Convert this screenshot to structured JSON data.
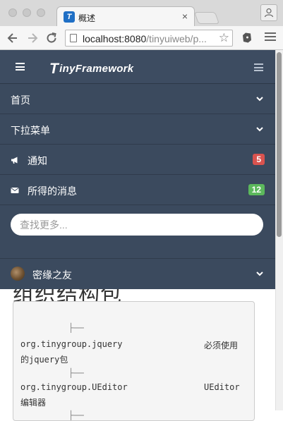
{
  "browser": {
    "tab_title": "概述",
    "tab_close": "×",
    "url_host": "localhost:8080",
    "url_path": "/tinyuiweb/p...",
    "star": "☆"
  },
  "navbar": {
    "brand_initial": "T",
    "brand_rest": "inyFramework",
    "items": [
      {
        "label": "首页"
      },
      {
        "label": "下拉菜单"
      },
      {
        "label": "通知",
        "badge": "5",
        "badge_color": "#d9534f"
      },
      {
        "label": "所得的消息",
        "badge": "12",
        "badge_color": "#5cb85c"
      }
    ],
    "search_placeholder": "查找更多...",
    "user_name": "密缘之友"
  },
  "page": {
    "heading_partial": "组织结构包",
    "code_lines": [
      {
        "tree": "├──"
      },
      {
        "package": "org.tinygroup.jquery",
        "desc": "必须使用"
      },
      {
        "desc_cont": "的jquery包"
      },
      {
        "tree": "├──"
      },
      {
        "package": "org.tinygroup.UEditor",
        "desc": "UEditor"
      },
      {
        "desc_cont": "编辑器"
      },
      {
        "tree": "├──"
      }
    ]
  },
  "colors": {
    "nav_bg": "#3b4a5e",
    "badge_red": "#d9534f",
    "badge_green": "#5cb85c"
  }
}
